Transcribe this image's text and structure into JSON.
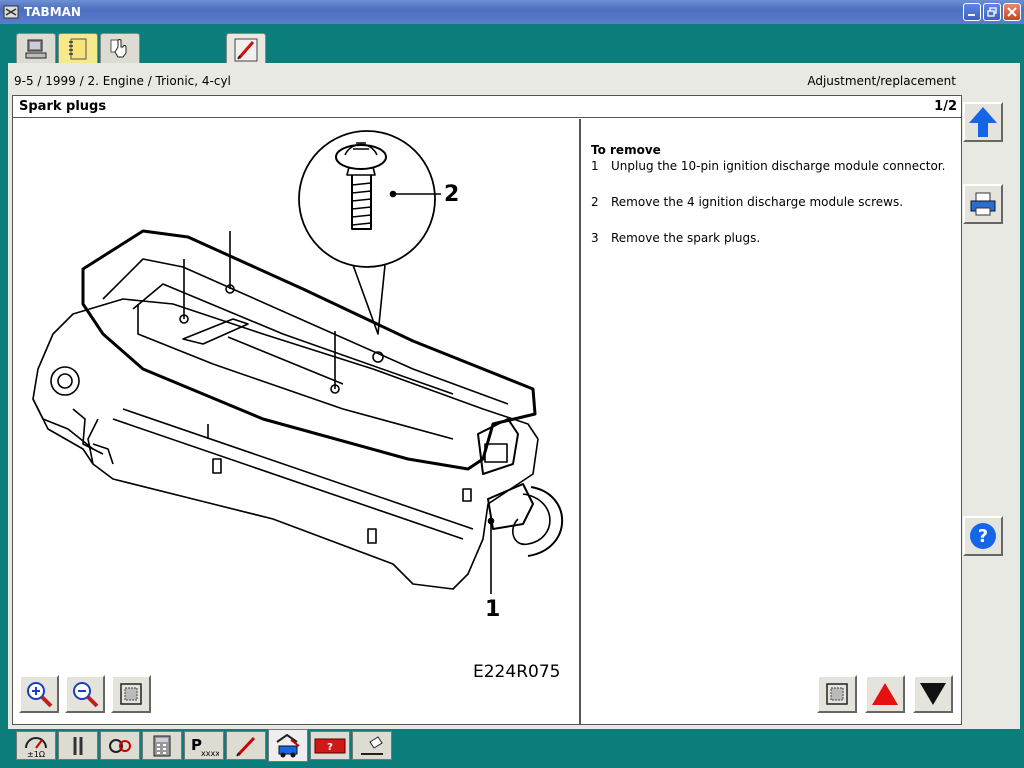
{
  "window": {
    "title": "TABMAN"
  },
  "top_tabs": [
    {
      "name": "computer-icon"
    },
    {
      "name": "notebook-icon"
    },
    {
      "name": "hand-pointer-icon"
    },
    {
      "name": "pen-icon"
    }
  ],
  "breadcrumb": "9-5 / 1999 / 2. Engine / Trionic, 4-cyl",
  "page_type": "Adjustment/replacement",
  "content": {
    "title": "Spark plugs",
    "page_counter": "1/2",
    "image_code": "E224R075",
    "callouts": {
      "one": "1",
      "two": "2"
    },
    "instructions": {
      "heading": "To remove",
      "steps": [
        {
          "num": "1",
          "text": "Unplug the 10-pin ignition discharge module connector."
        },
        {
          "num": "2",
          "text": "Remove the 4 ignition discharge module screws."
        },
        {
          "num": "3",
          "text": "Remove the spark plugs."
        }
      ]
    }
  },
  "bottom_toolbar": [
    {
      "name": "multimeter-icon"
    },
    {
      "name": "wrench-icon"
    },
    {
      "name": "gear-diagnosis-icon"
    },
    {
      "name": "calculator-icon"
    },
    {
      "name": "part-number-icon"
    },
    {
      "name": "pen-icon"
    },
    {
      "name": "car-service-icon"
    },
    {
      "name": "fault-code-icon"
    },
    {
      "name": "note-icon"
    }
  ],
  "colors": {
    "accent_blue": "#1565e8",
    "arrow_red": "#e61010",
    "background_teal": "#0b7d7a"
  }
}
